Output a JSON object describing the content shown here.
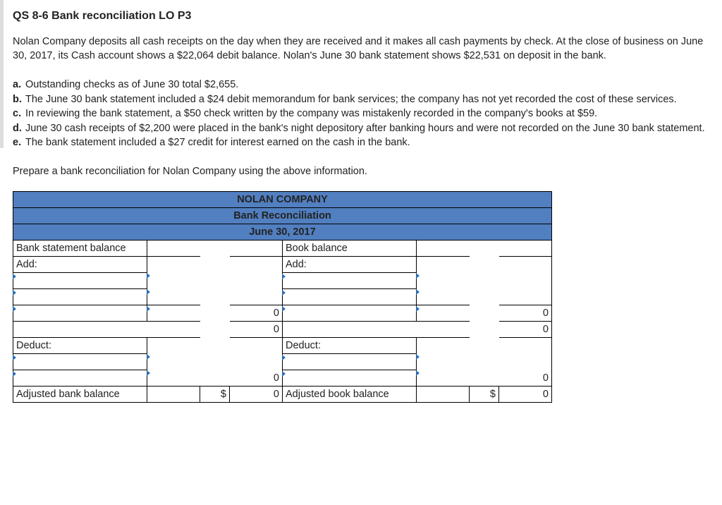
{
  "title": "QS 8-6 Bank reconciliation LO P3",
  "intro": "Nolan Company deposits all cash receipts on the day when they are received and it makes all cash payments by check. At the close of business on June 30, 2017, its Cash account shows a $22,064 debit balance. Nolan's June 30 bank statement shows $22,531 on deposit in the bank.",
  "items": [
    {
      "marker": "a.",
      "text": "Outstanding checks as of June 30 total $2,655."
    },
    {
      "marker": "b.",
      "text": "The June 30 bank statement included a $24 debit memorandum for bank services; the company has not yet recorded the cost of these services."
    },
    {
      "marker": "c.",
      "text": "In reviewing the bank statement, a $50 check written by the company was mistakenly recorded in the company's books at $59."
    },
    {
      "marker": "d.",
      "text": "June 30 cash receipts of $2,200 were placed in the bank's night depository after banking hours and were not recorded on the June 30 bank statement."
    },
    {
      "marker": "e.",
      "text": "The bank statement included a $27 credit for interest earned on the cash in the bank."
    }
  ],
  "instruction": "Prepare a bank reconciliation for Nolan Company using the above information.",
  "table": {
    "company": "NOLAN COMPANY",
    "title": "Bank Reconciliation",
    "date": "June 30, 2017",
    "labels": {
      "bank_stmt": "Bank statement balance",
      "book_bal": "Book balance",
      "add": "Add:",
      "deduct": "Deduct:",
      "adj_bank": "Adjusted bank balance",
      "adj_book": "Adjusted book balance",
      "dollar": "$",
      "zero": "0"
    }
  }
}
